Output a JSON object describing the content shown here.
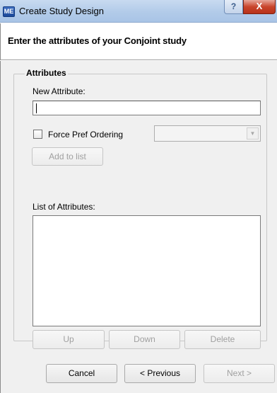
{
  "window": {
    "app_icon_text": "ME",
    "title": "Create Study Design",
    "help_glyph": "?",
    "close_glyph": "X"
  },
  "header": {
    "text": "Enter the attributes of your Conjoint study"
  },
  "attributes": {
    "legend": "Attributes",
    "new_attribute_label": "New Attribute:",
    "new_attribute_value": "",
    "force_pref_label": "Force Pref Ordering",
    "force_pref_checked": false,
    "ordering_selected": "",
    "add_button": "Add to list",
    "list_label": "List of Attributes:",
    "list_items": [],
    "up_button": "Up",
    "down_button": "Down",
    "delete_button": "Delete"
  },
  "footer": {
    "cancel_button": "Cancel",
    "previous_button": "< Previous",
    "next_button": "Next >"
  },
  "colors": {
    "titlebar": "#b9cfeb",
    "close": "#c9452c",
    "panel": "#f0f0f0"
  }
}
